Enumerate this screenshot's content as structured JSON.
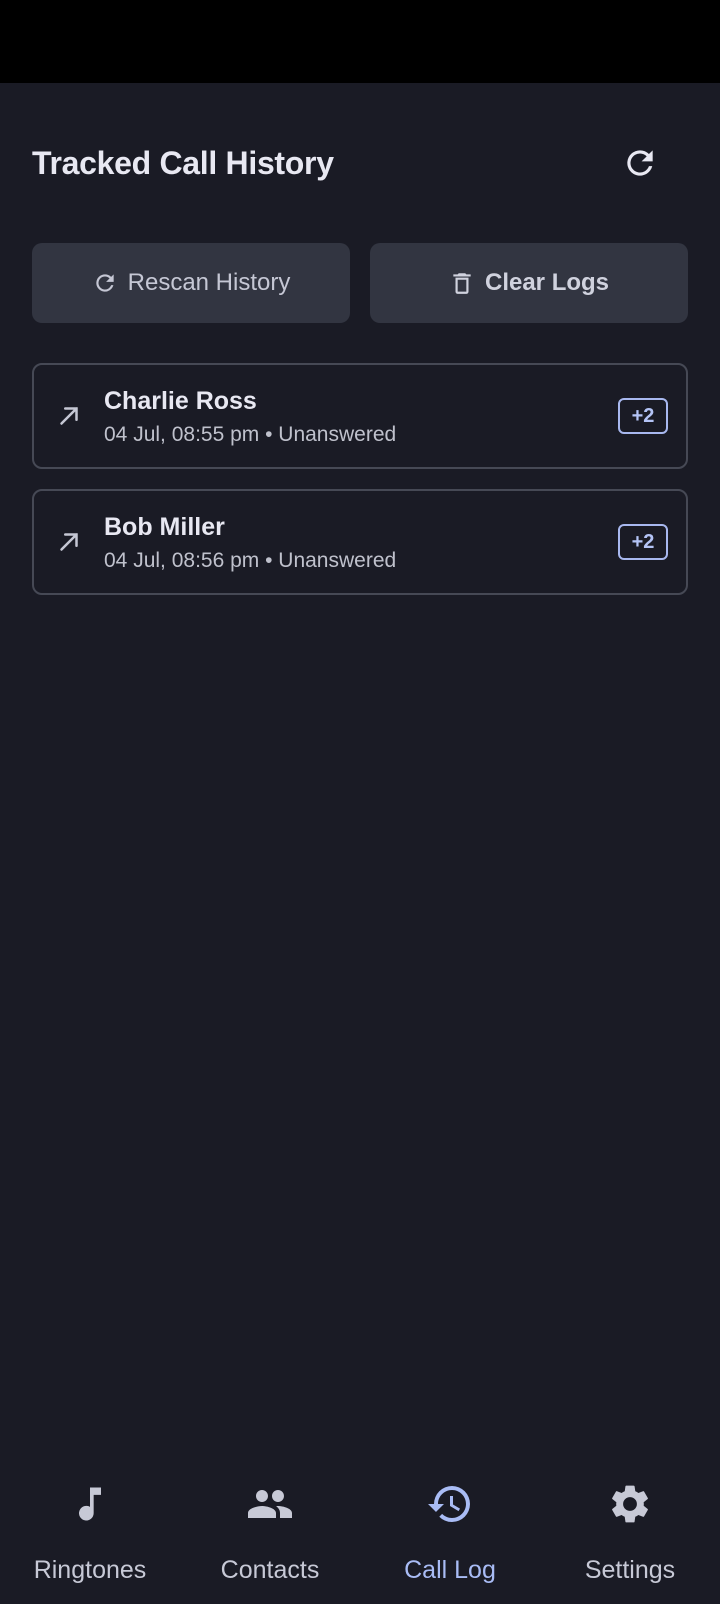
{
  "header": {
    "title": "Tracked Call History",
    "refresh_icon": "refresh-icon"
  },
  "actions": {
    "rescan_label": "Rescan History",
    "rescan_icon": "refresh-icon",
    "clear_label": "Clear Logs",
    "clear_icon": "trash-icon"
  },
  "calls": [
    {
      "name": "Charlie Ross",
      "meta": "04 Jul, 08:55 pm • Unanswered",
      "badge": "+2",
      "direction_icon": "outgoing-call-icon"
    },
    {
      "name": "Bob Miller",
      "meta": "04 Jul, 08:56 pm • Unanswered",
      "badge": "+2",
      "direction_icon": "outgoing-call-icon"
    }
  ],
  "nav": {
    "items": [
      {
        "label": "Ringtones",
        "icon": "music-note-icon"
      },
      {
        "label": "Contacts",
        "icon": "people-icon"
      },
      {
        "label": "Call Log",
        "icon": "history-icon",
        "active": true
      },
      {
        "label": "Settings",
        "icon": "gear-icon"
      }
    ]
  },
  "colors": {
    "background": "#1a1b25",
    "button": "#323541",
    "accent": "#a9bcf5"
  }
}
